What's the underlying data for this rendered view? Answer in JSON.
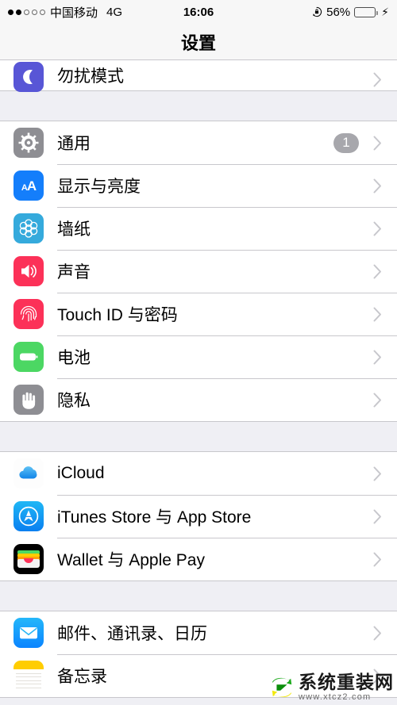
{
  "status_bar": {
    "signal_dots_filled": 2,
    "signal_dots_total": 5,
    "carrier": "中国移动",
    "network": "4G",
    "time": "16:06",
    "rotation_lock_icon": "rotation-lock-icon",
    "battery_percent": "56%",
    "battery_level": 56,
    "battery_color": "#ffcc00",
    "charging_icon": "⚡"
  },
  "nav": {
    "title": "设置"
  },
  "sections": [
    {
      "id": "dnd-section",
      "clipped": true,
      "rows": [
        {
          "label": "勿扰模式",
          "icon": "moon-icon",
          "icon_class": "ico-dnd",
          "badge": null,
          "partial": true
        }
      ]
    },
    {
      "id": "device-section",
      "clipped": false,
      "rows": [
        {
          "label": "通用",
          "icon": "gear-icon",
          "icon_class": "ico-general",
          "badge": "1",
          "partial": false
        },
        {
          "label": "显示与亮度",
          "icon": "aa-icon",
          "icon_class": "ico-display",
          "badge": null,
          "partial": false
        },
        {
          "label": "墙纸",
          "icon": "flower-icon",
          "icon_class": "ico-wallpaper",
          "badge": null,
          "partial": false
        },
        {
          "label": "声音",
          "icon": "speaker-icon",
          "icon_class": "ico-sound",
          "badge": null,
          "partial": false
        },
        {
          "label": "Touch ID 与密码",
          "icon": "fingerprint-icon",
          "icon_class": "ico-touchid",
          "badge": null,
          "partial": false
        },
        {
          "label": "电池",
          "icon": "battery-icon",
          "icon_class": "ico-battery",
          "badge": null,
          "partial": false
        },
        {
          "label": "隐私",
          "icon": "hand-icon",
          "icon_class": "ico-privacy",
          "badge": null,
          "partial": false
        }
      ]
    },
    {
      "id": "accounts-section",
      "clipped": false,
      "rows": [
        {
          "label": "iCloud",
          "icon": "cloud-icon",
          "icon_class": "ico-icloud",
          "badge": null,
          "partial": false
        },
        {
          "label": "iTunes Store 与 App Store",
          "icon": "app-store-icon",
          "icon_class": "ico-appstore",
          "badge": null,
          "partial": false
        },
        {
          "label": "Wallet 与 Apple Pay",
          "icon": "wallet-icon",
          "icon_class": "ico-wallet",
          "badge": null,
          "partial": false
        }
      ]
    },
    {
      "id": "apps-section",
      "clipped": false,
      "rows": [
        {
          "label": "邮件、通讯录、日历",
          "icon": "mail-icon",
          "icon_class": "ico-mail",
          "badge": null,
          "partial": false
        },
        {
          "label": "备忘录",
          "icon": "notes-icon",
          "icon_class": "ico-notes",
          "badge": null,
          "partial": false
        }
      ]
    }
  ],
  "watermark": {
    "title": "系统重装网",
    "url": "www.xtcz2.com"
  }
}
